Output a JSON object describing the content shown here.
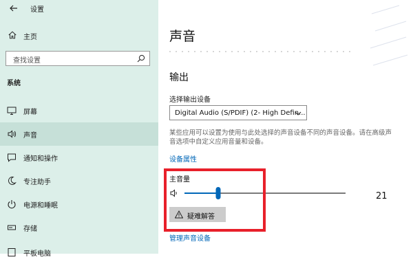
{
  "window": {
    "title": "设置"
  },
  "sidebar": {
    "home_label": "主页",
    "search_placeholder": "查找设置",
    "section_title": "系统",
    "items": [
      {
        "label": "屏幕",
        "icon": "monitor-icon"
      },
      {
        "label": "声音",
        "icon": "speaker-icon",
        "active": true
      },
      {
        "label": "通知和操作",
        "icon": "notification-icon"
      },
      {
        "label": "专注助手",
        "icon": "moon-icon"
      },
      {
        "label": "电源和睡眠",
        "icon": "power-icon"
      },
      {
        "label": "存储",
        "icon": "storage-icon"
      },
      {
        "label": "平板电脑",
        "icon": "tablet-icon"
      }
    ]
  },
  "main": {
    "page_title": "声音",
    "output_title": "输出",
    "output_device_label": "选择输出设备",
    "output_device_value": "Digital Audio (S/PDIF) (2- High Defin...",
    "description": "某些应用可以设置为使用与此处选择的声音设备不同的声音设备。请在高级声音选项中自定义应用音量和设备。",
    "device_properties_link": "设备属性",
    "master_volume_label": "主音量",
    "volume_value": "21",
    "volume_level_percent": 21,
    "troubleshoot_label": "疑难解答",
    "manage_devices_link": "管理声音设备"
  },
  "colors": {
    "sidebar_bg": "#dcefe9",
    "accent": "#0067b8",
    "highlight_border": "#e8202a"
  }
}
